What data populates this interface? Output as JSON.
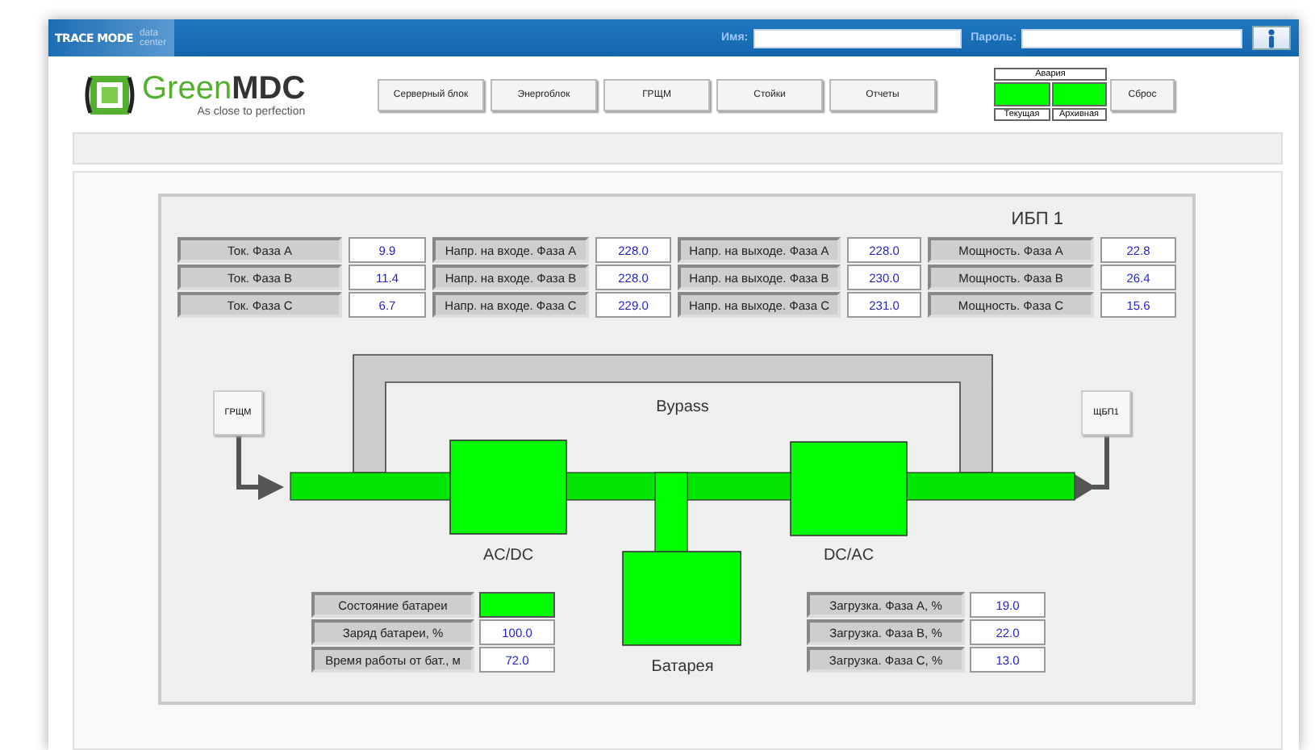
{
  "header": {
    "logo_text": "TRACE MODE",
    "logo_sub": "data center",
    "name_label": "Имя:",
    "password_label": "Пароль:"
  },
  "brand": {
    "name_light": "Green",
    "name_bold": "MDC",
    "tagline": "As close to perfection"
  },
  "nav": [
    "Серверный блок",
    "Энергоблок",
    "ГРЩМ",
    "Стойки",
    "Отчеты"
  ],
  "alarm": {
    "title": "Авария",
    "indicators": [
      {
        "label": "Текущая",
        "color": "#00ff00"
      },
      {
        "label": "Архивная",
        "color": "#00ff00"
      }
    ],
    "reset": "Сброс"
  },
  "panel": {
    "title": "ИБП 1",
    "measurements": [
      [
        {
          "label": "Ток. Фаза A",
          "value": "9.9"
        },
        {
          "label": "Напр. на входе. Фаза A",
          "value": "228.0"
        },
        {
          "label": "Напр. на выходе. Фаза A",
          "value": "228.0"
        },
        {
          "label": "Мощность. Фаза A",
          "value": "22.8"
        }
      ],
      [
        {
          "label": "Ток. Фаза B",
          "value": "11.4"
        },
        {
          "label": "Напр. на входе. Фаза B",
          "value": "228.0"
        },
        {
          "label": "Напр. на выходе. Фаза B",
          "value": "230.0"
        },
        {
          "label": "Мощность. Фаза B",
          "value": "26.4"
        }
      ],
      [
        {
          "label": "Ток. Фаза C",
          "value": "6.7"
        },
        {
          "label": "Напр. на входе. Фаза C",
          "value": "229.0"
        },
        {
          "label": "Напр. на выходе. Фаза C",
          "value": "231.0"
        },
        {
          "label": "Мощность. Фаза C",
          "value": "15.6"
        }
      ]
    ],
    "diagram": {
      "bypass_label": "Bypass",
      "input_node": "ГРЩМ",
      "output_node": "ЩБП1",
      "rectifier_label": "AC/DC",
      "inverter_label": "DC/AC",
      "battery_label": "Батарея"
    },
    "battery": [
      {
        "kind": "indicator",
        "label": "Состояние батареи",
        "color": "#00ff00"
      },
      {
        "kind": "value",
        "label": "Заряд батареи, %",
        "value": "100.0"
      },
      {
        "kind": "value",
        "label": "Время работы от бат., м",
        "value": "72.0"
      }
    ],
    "load": [
      {
        "label": "Загрузка. Фаза A, %",
        "value": "19.0"
      },
      {
        "label": "Загрузка. Фаза B, %",
        "value": "22.0"
      },
      {
        "label": "Загрузка. Фаза C, %",
        "value": "13.0"
      }
    ]
  }
}
